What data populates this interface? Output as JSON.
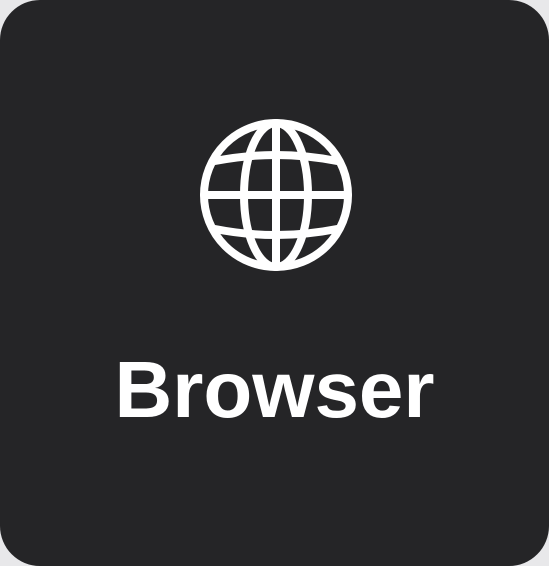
{
  "app_tile": {
    "label": "Browser",
    "icon": "globe-icon",
    "background_color": "#252527",
    "foreground_color": "#ffffff"
  }
}
